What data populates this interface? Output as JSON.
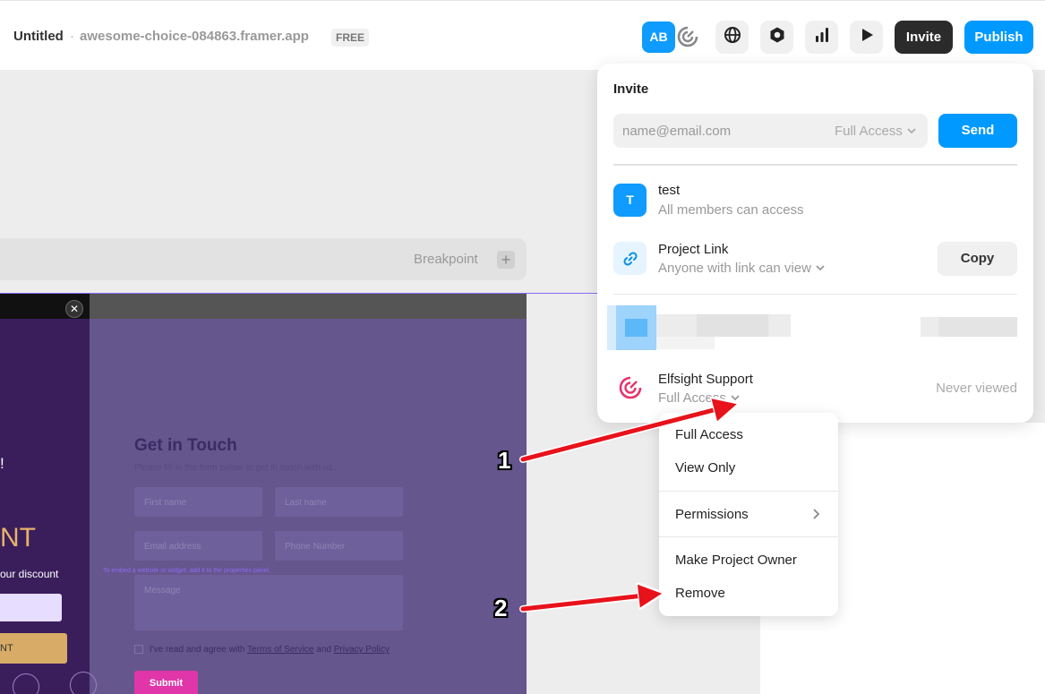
{
  "header": {
    "title": "Untitled",
    "separator": "·",
    "url": "awesome-choice-084863.framer.app",
    "plan_badge": "FREE",
    "avatar_initials": "AB",
    "invite_label": "Invite",
    "publish_label": "Publish",
    "icons": [
      "elfsight-avatar-icon",
      "globe-icon",
      "hexagon-icon",
      "analytics-icon",
      "play-icon"
    ],
    "colors": {
      "accent": "#0099ff",
      "dark": "#2b2b2b"
    }
  },
  "canvas": {
    "breakpoint_label": "Breakpoint",
    "breakpoint_add": "+",
    "popup": {
      "close": "✕",
      "headline_fragment": "!",
      "big_text_fragment": "NT",
      "discount_text": "our discount",
      "cta_fragment": "NT"
    },
    "form": {
      "title": "Get in Touch",
      "subtitle": "Please fill in the form below to get in touch with us.",
      "first_name": "First name",
      "last_name": "Last name",
      "email": "Email address",
      "phone": "Phone Number",
      "message": "Message",
      "embed_hint": "To embed a website or widget, add it to the properties panel.",
      "agree_prefix": "I've read and agree with ",
      "terms": "Terms of Service",
      "and": " and ",
      "privacy": "Privacy Policy",
      "submit": "Submit"
    }
  },
  "invite_panel": {
    "title": "Invite",
    "email_placeholder": "name@email.com",
    "access_select": "Full Access",
    "send_label": "Send",
    "members": [
      {
        "initial": "T",
        "name": "test",
        "sub": "All members can access"
      },
      {
        "name": "Project Link",
        "sub": "Anyone with link can view",
        "action": "Copy"
      },
      {
        "name": "Elfsight Support",
        "sub": "Full Access",
        "status": "Never viewed"
      }
    ]
  },
  "dropdown": {
    "items": [
      "Full Access",
      "View Only",
      "Permissions",
      "Make Project Owner",
      "Remove"
    ]
  },
  "annotations": {
    "labels": [
      "1",
      "2"
    ],
    "arrow_color": "#e8121b"
  }
}
